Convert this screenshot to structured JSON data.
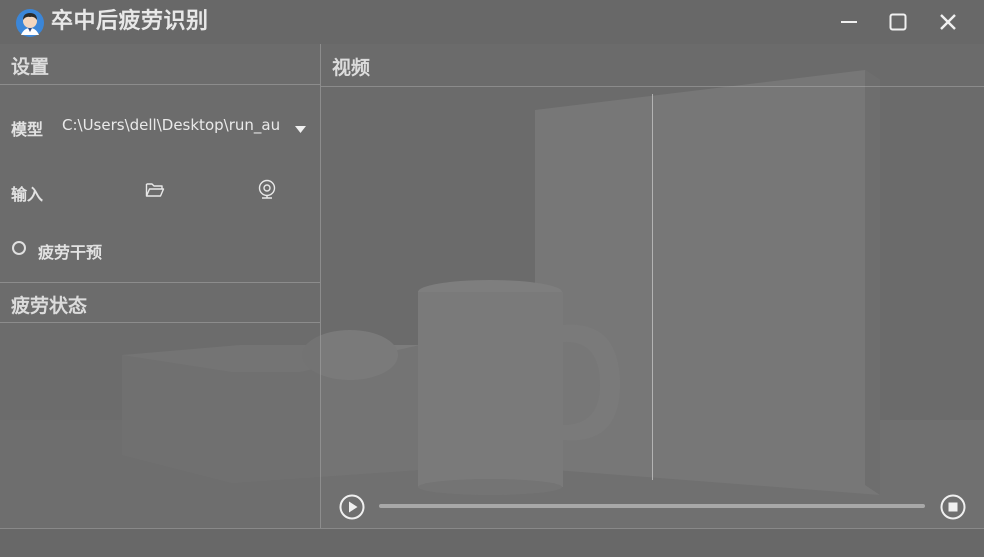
{
  "window": {
    "title": "卒中后疲劳识别",
    "minimize_icon": "minimize-icon",
    "maximize_icon": "maximize-icon",
    "close_icon": "close-icon"
  },
  "settings": {
    "header": "设置",
    "model_label": "模型",
    "model_path": "C:\\Users\\dell\\Desktop\\run_au",
    "input_label": "输入",
    "input_icons": [
      "folder-icon",
      "webcam-icon"
    ],
    "fatigue_intervention_label": "疲劳干预",
    "fatigue_intervention_checked": false
  },
  "fatigue_status": {
    "header": "疲劳状态"
  },
  "video": {
    "header": "视频",
    "progress": 0,
    "play_icon": "play-icon",
    "stop_icon": "stop-icon"
  },
  "colors": {
    "background": "#6a6a6a",
    "text": "#e2e2e2",
    "accent_icon": "#3b86d8"
  }
}
